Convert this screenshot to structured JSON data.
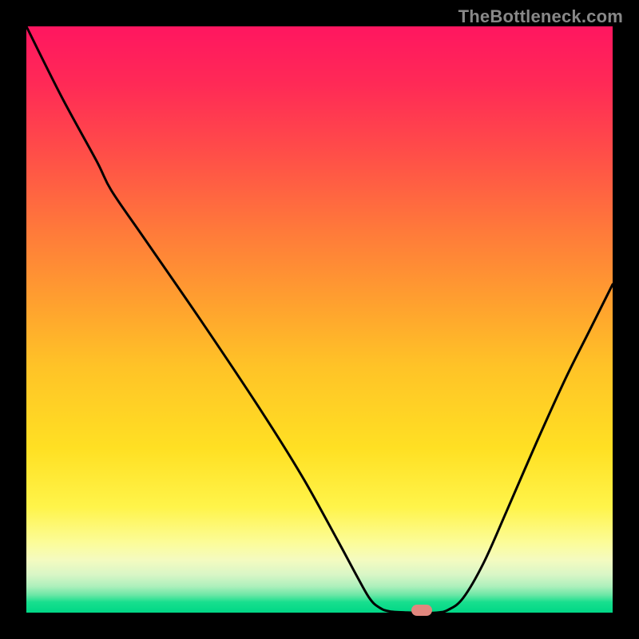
{
  "watermark": "TheBottleneck.com",
  "colors": {
    "background": "#000000",
    "curve": "#000000",
    "marker": "#e1877e",
    "gradient_stops": [
      "#ff1660",
      "#ff2a56",
      "#ff4f48",
      "#ff7a3a",
      "#ffa32e",
      "#ffc327",
      "#ffe023",
      "#fff44a",
      "#fcfc98",
      "#f4fbc0",
      "#d9f6c6",
      "#aef0bc",
      "#6be7a6",
      "#18df8e",
      "#00d786"
    ]
  },
  "chart_data": {
    "type": "line",
    "title": "",
    "xlabel": "",
    "ylabel": "",
    "xlim": [
      0,
      1
    ],
    "ylim": [
      0,
      1
    ],
    "series": [
      {
        "name": "curve",
        "points": [
          {
            "x": 0.0,
            "y": 1.0
          },
          {
            "x": 0.06,
            "y": 0.88
          },
          {
            "x": 0.12,
            "y": 0.77
          },
          {
            "x": 0.145,
            "y": 0.72
          },
          {
            "x": 0.2,
            "y": 0.64
          },
          {
            "x": 0.3,
            "y": 0.495
          },
          {
            "x": 0.4,
            "y": 0.345
          },
          {
            "x": 0.47,
            "y": 0.233
          },
          {
            "x": 0.53,
            "y": 0.125
          },
          {
            "x": 0.565,
            "y": 0.06
          },
          {
            "x": 0.585,
            "y": 0.025
          },
          {
            "x": 0.6,
            "y": 0.01
          },
          {
            "x": 0.62,
            "y": 0.002
          },
          {
            "x": 0.66,
            "y": 0.0
          },
          {
            "x": 0.7,
            "y": 0.0
          },
          {
            "x": 0.72,
            "y": 0.005
          },
          {
            "x": 0.745,
            "y": 0.025
          },
          {
            "x": 0.78,
            "y": 0.085
          },
          {
            "x": 0.82,
            "y": 0.175
          },
          {
            "x": 0.87,
            "y": 0.29
          },
          {
            "x": 0.92,
            "y": 0.4
          },
          {
            "x": 0.96,
            "y": 0.48
          },
          {
            "x": 1.0,
            "y": 0.56
          }
        ]
      }
    ],
    "marker": {
      "x": 0.675,
      "y": 0.004
    }
  }
}
